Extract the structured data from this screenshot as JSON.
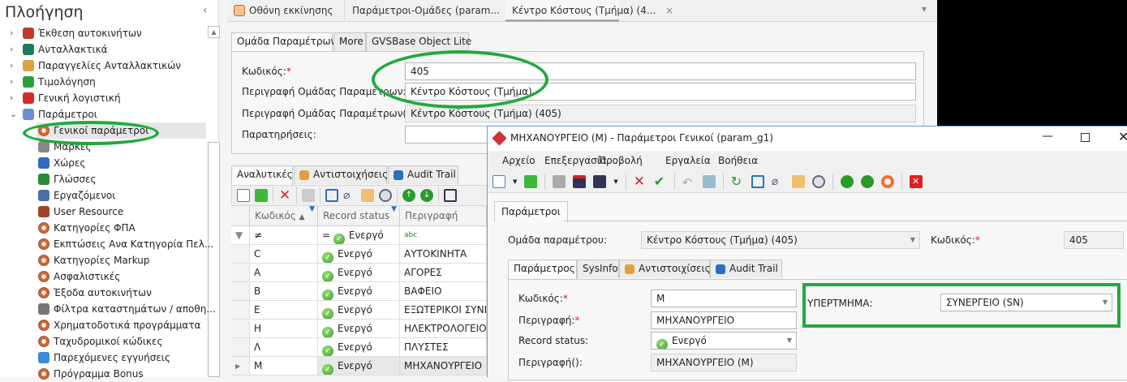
{
  "nav": {
    "title": "Πλοήγηση",
    "items": [
      {
        "label": "Έκθεση αυτοκινήτων",
        "level": 1,
        "icon": "car-icon",
        "color": "#c0392b"
      },
      {
        "label": "Ανταλλακτικά",
        "level": 1,
        "icon": "wrench-icon",
        "color": "#1e7b63"
      },
      {
        "label": "Παραγγελίες Ανταλλακτικών",
        "level": 1,
        "icon": "package-icon",
        "color": "#d9a441"
      },
      {
        "label": "Τιμολόγηση",
        "level": 1,
        "icon": "invoice-icon",
        "color": "#2e9e3a"
      },
      {
        "label": "Γενική λογιστική",
        "level": 1,
        "icon": "gl-icon",
        "color": "#d42a2a"
      },
      {
        "label": "Παράμετροι",
        "level": 1,
        "icon": "parameters-icon",
        "color": "#6b8fd1",
        "expanded": true
      },
      {
        "label": "Γενικοί παράμετροι",
        "level": 2,
        "icon": "compass-icon",
        "selected": true
      },
      {
        "label": "Μάρκες",
        "level": 2,
        "icon": "factory-icon",
        "color": "#888"
      },
      {
        "label": "Χώρες",
        "level": 2,
        "icon": "flag-globe-icon",
        "color": "#2d6bc4"
      },
      {
        "label": "Γλώσσες",
        "level": 2,
        "icon": "globe-icon",
        "color": "#2a8a3a"
      },
      {
        "label": "Εργαζόμενοι",
        "level": 2,
        "icon": "worker-icon",
        "color": "#4a6fa5"
      },
      {
        "label": "User Resource",
        "level": 2,
        "icon": "user-key-icon",
        "color": "#a0442a"
      },
      {
        "label": "Κατηγορίες ΦΠΑ",
        "level": 2,
        "icon": "compass-icon"
      },
      {
        "label": "Εκπτώσεις Ανα Κατηγορία Πελ...",
        "level": 2,
        "icon": "compass-icon"
      },
      {
        "label": "Κατηγορίες Markup",
        "level": 2,
        "icon": "compass-icon"
      },
      {
        "label": "Ασφαλιστικές",
        "level": 2,
        "icon": "compass-icon"
      },
      {
        "label": "Έξοδα αυτοκινήτων",
        "level": 2,
        "icon": "compass-icon"
      },
      {
        "label": "Φίλτρα καταστημάτων / αποθη...",
        "level": 2,
        "icon": "funnel-icon",
        "color": "#777"
      },
      {
        "label": "Χρηματοδοτικά προγράμματα",
        "level": 2,
        "icon": "compass-icon"
      },
      {
        "label": "Ταχυδρομικοί κώδικες",
        "level": 2,
        "icon": "compass-icon"
      },
      {
        "label": "Παρεχόμενες εγγυήσεις",
        "level": 2,
        "icon": "certificate-icon",
        "color": "#3a8ad6"
      },
      {
        "label": "Πρόγραμμα Bonus",
        "level": 2,
        "icon": "compass-icon"
      }
    ]
  },
  "doc_tabs": [
    "Οθόνη εκκίνησης",
    "Παράμετροι-Ομάδες (param...",
    "Κέντρο Κόστους (Τμήμα) (4..."
  ],
  "group": {
    "tabs": [
      "Ομάδα Παραμέτρων",
      "More",
      "GVSBase Object Lite"
    ],
    "fields": [
      {
        "label": "Κωδικός:",
        "required": "*",
        "value": "405"
      },
      {
        "label": "Περιγραφή Ομάδας Παραμέτρων:",
        "required": "*",
        "value": "Κέντρο Κόστους (Τμήμα)"
      },
      {
        "label": "Περιγραφή Ομάδας Παραμέτρων():",
        "required": "",
        "value": "Κέντρο Κόστους (Τμήμα) (405)"
      },
      {
        "label": "Παρατηρήσεις:",
        "required": "",
        "value": ""
      }
    ]
  },
  "detail": {
    "tabs": [
      "Αναλυτικές",
      "Αντιστοιχήσεις",
      "Audit Trail"
    ],
    "columns": [
      "Κωδικός",
      "Record status",
      "Περιγραφή"
    ],
    "filter": {
      "code": "≠",
      "status_op": "=",
      "status": "Ενεργό",
      "desc": "abc"
    },
    "rows": [
      {
        "code": "C",
        "status": "Ενεργό",
        "desc": "ΑΥΤΟΚΙΝΗΤΑ"
      },
      {
        "code": "A",
        "status": "Ενεργό",
        "desc": "ΑΓΟΡΕΣ"
      },
      {
        "code": "B",
        "status": "Ενεργό",
        "desc": "ΒΑΦΕΙΟ"
      },
      {
        "code": "E",
        "status": "Ενεργό",
        "desc": "ΕΞΩΤΕΡΙΚΟΙ ΣΥΝΕ"
      },
      {
        "code": "H",
        "status": "Ενεργό",
        "desc": "ΗΛΕΚΤΡΟΛΟΓΕΙΟ"
      },
      {
        "code": "Λ",
        "status": "Ενεργό",
        "desc": "ΠΛΥΣΤΕΣ"
      },
      {
        "code": "M",
        "status": "Ενεργό",
        "desc": "ΜΗΧΑΝΟΥΡΓΕΙΟ",
        "current": true
      }
    ]
  },
  "dialog": {
    "title": "ΜΗΧΑΝΟΥΡΓΕΙΟ (M) - Παράμετροι Γενικοί (param_g1)",
    "menu": [
      "Αρχείο",
      "Επεξεργασία",
      "Προβολή",
      "Εργαλεία",
      "Βοήθεια"
    ],
    "outer_tab": "Παράμετροι",
    "group_label": "Ομάδα παραμέτρου:",
    "group_value": "Κέντρο Κόστους (Τμήμα) (405)",
    "code_label": "Κωδικός:",
    "code_value": "405",
    "req": "*",
    "tabs": [
      "Παράμετρος",
      "SysInfo",
      "Αντιστοιχίσεις",
      "Audit Trail"
    ],
    "fields": [
      {
        "label": "Κωδικός:",
        "required": "*",
        "value": "M"
      },
      {
        "label": "Περιγραφή:",
        "required": "*",
        "value": "ΜΗΧΑΝΟΥΡΓΕΙΟ"
      },
      {
        "label": "Record status:",
        "required": "",
        "value": "Ενεργό"
      },
      {
        "label": "Περιγραφή():",
        "required": "",
        "value": "ΜΗΧΑΝΟΥΡΓΕΙΟ (M)"
      }
    ],
    "parent_label": "ΥΠΕΡΤΜΗΜΑ:",
    "parent_value": "ΣΥΝΕΡΓΕΙΟ (SN)"
  },
  "colors": {
    "highlight": "#1faa3c",
    "required": "#e02020"
  }
}
